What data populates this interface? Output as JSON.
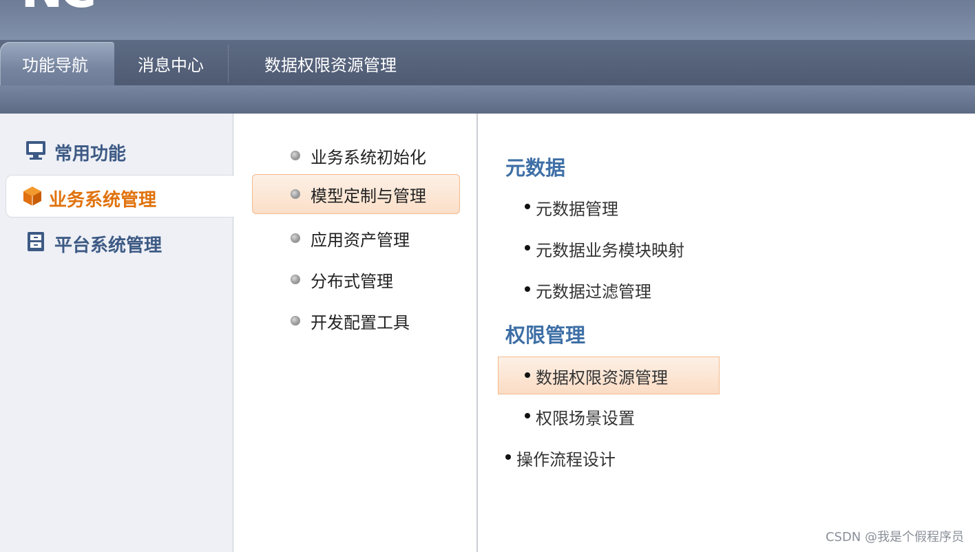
{
  "header": {
    "logo_text": "NC"
  },
  "tabs": [
    {
      "label": "功能导航",
      "active": true
    },
    {
      "label": "消息中心",
      "active": false
    },
    {
      "label": "数据权限资源管理",
      "active": false
    }
  ],
  "sidebar": {
    "items": [
      {
        "label": "常用功能",
        "icon": "monitor-icon",
        "active": false
      },
      {
        "label": "业务系统管理",
        "icon": "cube-icon",
        "active": true
      },
      {
        "label": "平台系统管理",
        "icon": "cabinet-icon",
        "active": false
      }
    ]
  },
  "middle_menu": {
    "items": [
      {
        "label": "业务系统初始化",
        "selected": false
      },
      {
        "label": "模型定制与管理",
        "selected": true
      },
      {
        "label": "应用资产管理",
        "selected": false
      },
      {
        "label": "分布式管理",
        "selected": false
      },
      {
        "label": "开发配置工具",
        "selected": false
      }
    ]
  },
  "content": {
    "sections": [
      {
        "title": "元数据",
        "items": [
          {
            "label": "元数据管理",
            "selected": false
          },
          {
            "label": "元数据业务模块映射",
            "selected": false
          },
          {
            "label": "元数据过滤管理",
            "selected": false
          }
        ]
      },
      {
        "title": "权限管理",
        "items": [
          {
            "label": "数据权限资源管理",
            "selected": true
          },
          {
            "label": "权限场景设置",
            "selected": false
          }
        ]
      }
    ],
    "standalone_item": {
      "label": "操作流程设计"
    }
  },
  "watermark": "CSDN @我是个假程序员",
  "colors": {
    "accent_orange": "#e0720c",
    "nav_text_blue": "#3d5a84",
    "section_title_blue": "#3e6fa6",
    "selection_fill": "#fbdfc8",
    "selection_border": "#f3b98c"
  }
}
